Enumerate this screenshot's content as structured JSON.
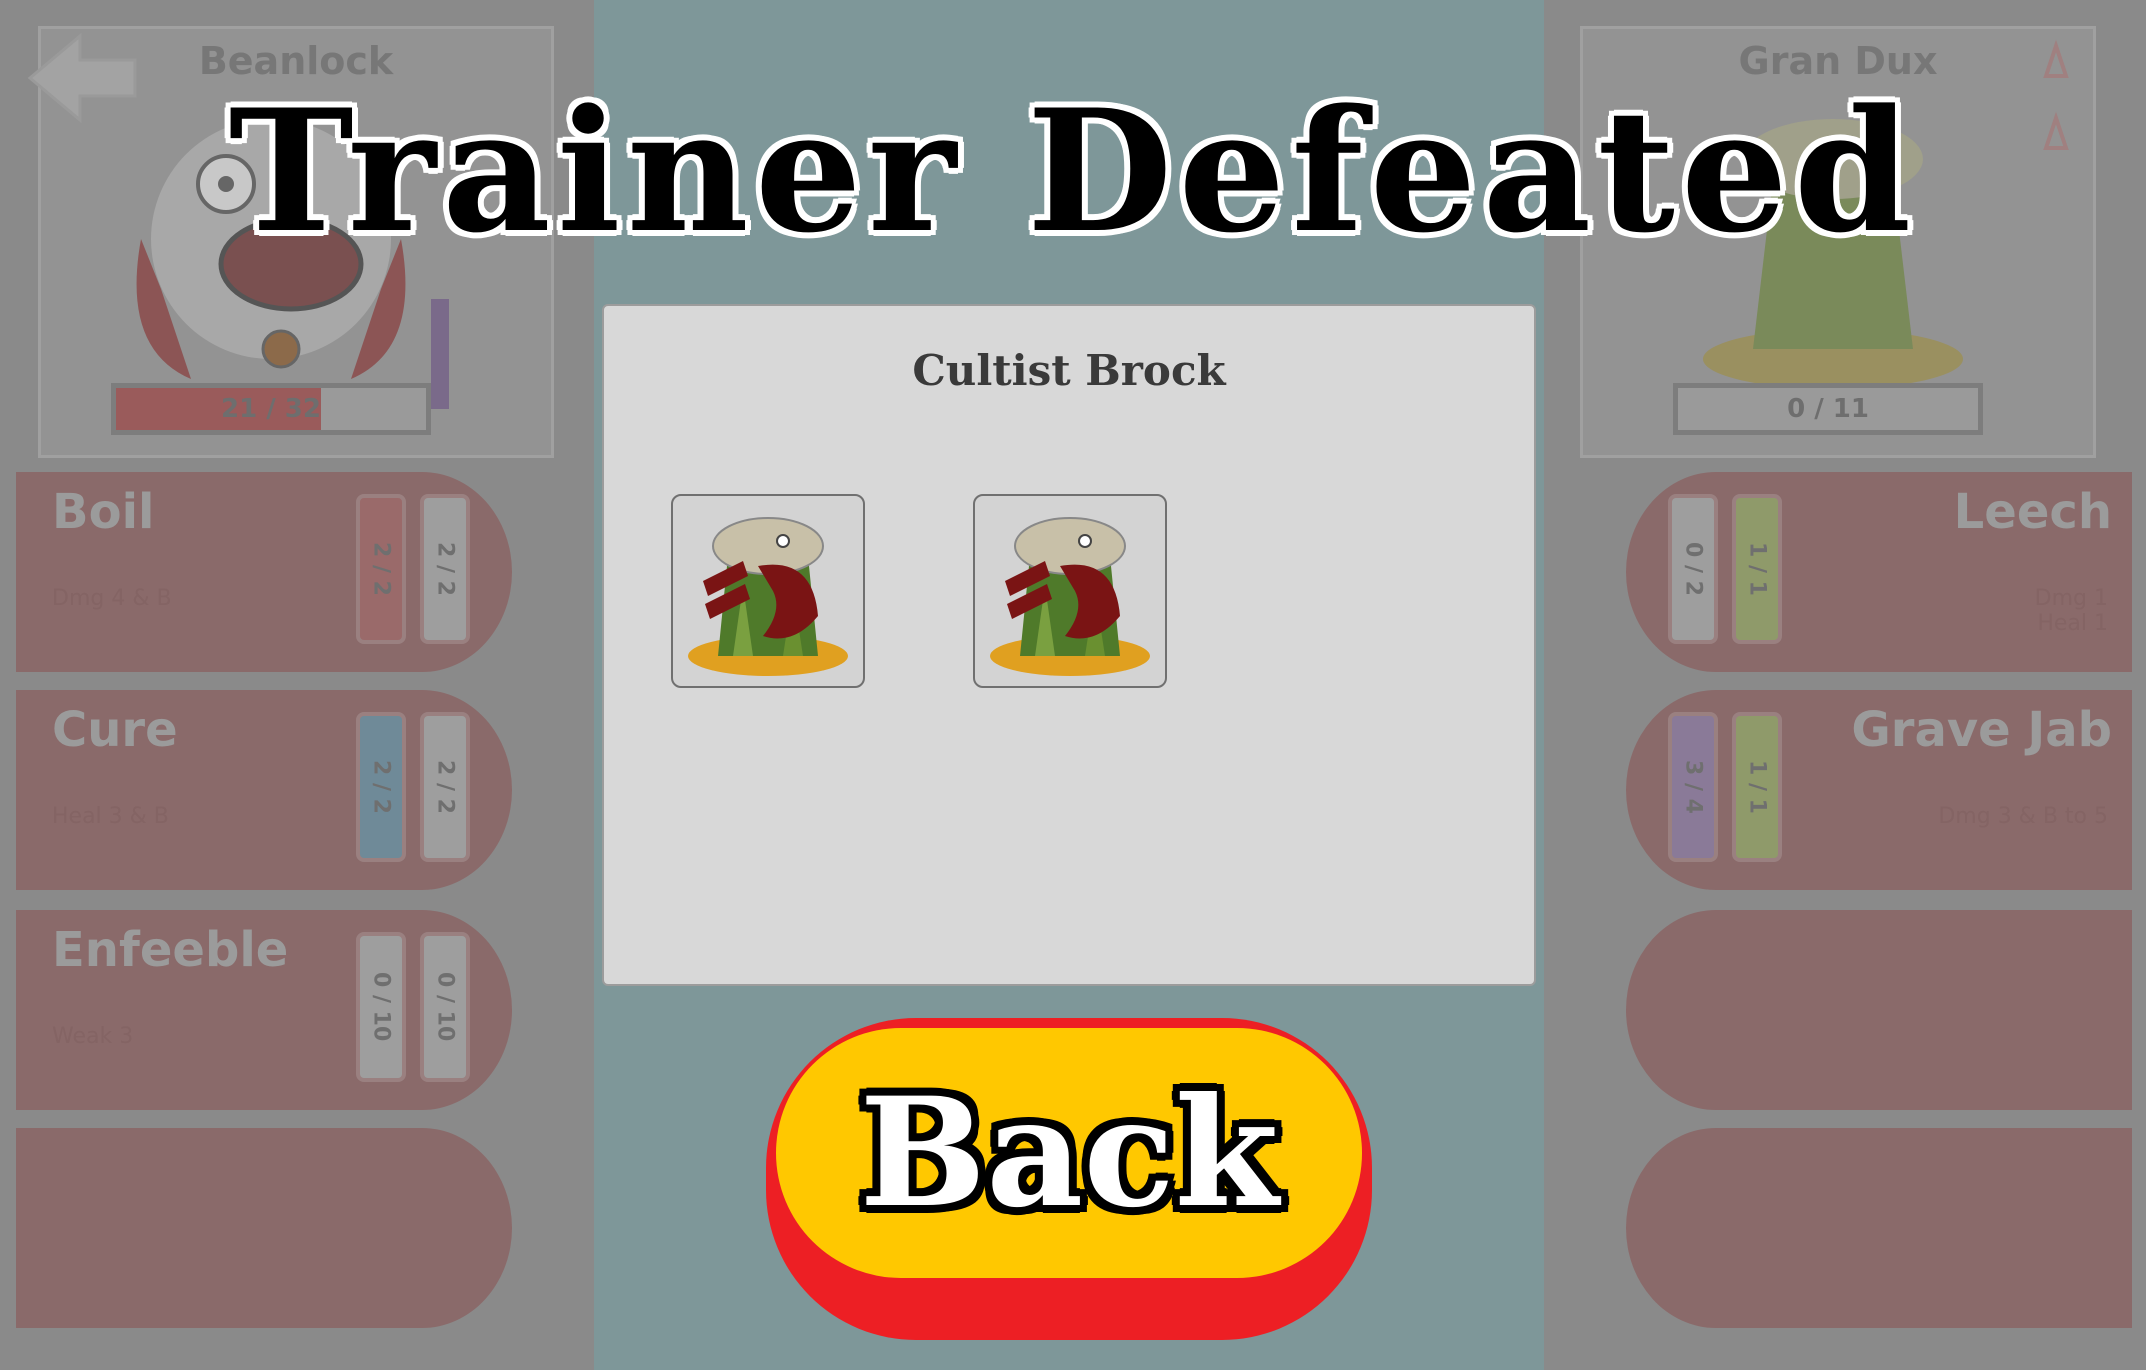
{
  "title": "Trainer Defeated",
  "dialog": {
    "trainer_name": "Cultist Brock",
    "rewards": [
      {
        "icon": "tree-monster-icon"
      },
      {
        "icon": "tree-monster-icon"
      }
    ]
  },
  "back_button": {
    "label": "Back"
  },
  "player_monster": {
    "name": "Beanlock",
    "hp_text": "21 / 32",
    "hp_fraction": 0.66,
    "moves": [
      {
        "name": "Boil",
        "desc": "Dmg 4 & B",
        "gauges": [
          "2 / 2",
          "2 / 2"
        ],
        "gauge_colors": [
          "#9a6a6a",
          "#9e9e9e"
        ]
      },
      {
        "name": "Cure",
        "desc": "Heal 3 & B",
        "gauges": [
          "2 / 2",
          "2 / 2"
        ],
        "gauge_colors": [
          "#6f8a98",
          "#9e9e9e"
        ]
      },
      {
        "name": "Enfeeble",
        "desc": "Weak 3",
        "gauges": [
          "0 / 10",
          "0 / 10"
        ],
        "gauge_colors": [
          "#9e9e9e",
          "#9e9e9e"
        ]
      }
    ]
  },
  "enemy_monster": {
    "name": "Gran Dux",
    "hp_text": "0 / 11",
    "hp_fraction": 0,
    "moves": [
      {
        "name": "Leech",
        "desc": "Dmg 1\nHeal 1",
        "gauges": [
          "0 / 2",
          "1 / 1"
        ],
        "gauge_colors": [
          "#9e9e9e",
          "#8f9a6a"
        ]
      },
      {
        "name": "Grave Jab",
        "desc": "Dmg 3 & B to 5",
        "gauges": [
          "3 / 4",
          "1 / 1"
        ],
        "gauge_colors": [
          "#8a7a98",
          "#8f9a6a"
        ]
      }
    ]
  },
  "colors": {
    "background": "#7e9799",
    "dialog": "#d8d8d8",
    "button_face": "#ffc800",
    "button_edge": "#ed1f24",
    "move_card": "#8a6a6a"
  }
}
